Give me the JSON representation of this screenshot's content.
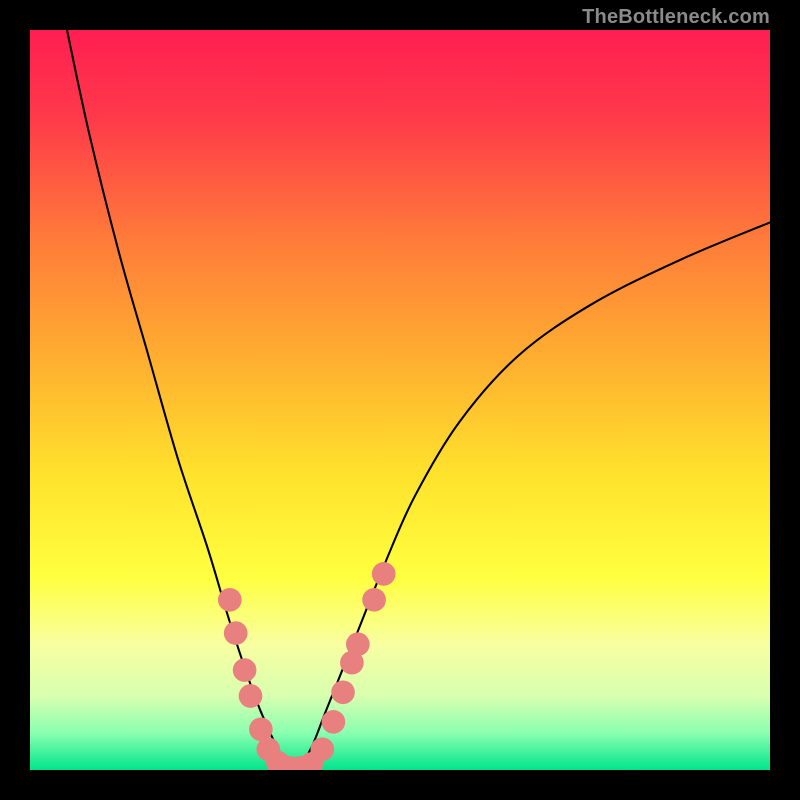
{
  "watermark": "TheBottleneck.com",
  "chart_data": {
    "type": "line",
    "title": "",
    "xlabel": "",
    "ylabel": "",
    "xlim": [
      0,
      100
    ],
    "ylim": [
      0,
      100
    ],
    "grid": false,
    "legend": false,
    "background_gradient": {
      "stops": [
        {
          "pos": 0.0,
          "color": "#ff1e52"
        },
        {
          "pos": 0.12,
          "color": "#ff3a4a"
        },
        {
          "pos": 0.28,
          "color": "#ff7a3a"
        },
        {
          "pos": 0.45,
          "color": "#ffb030"
        },
        {
          "pos": 0.6,
          "color": "#ffe22c"
        },
        {
          "pos": 0.74,
          "color": "#ffff40"
        },
        {
          "pos": 0.83,
          "color": "#f8ffa0"
        },
        {
          "pos": 0.9,
          "color": "#d8ffb0"
        },
        {
          "pos": 0.95,
          "color": "#8affb0"
        },
        {
          "pos": 1.0,
          "color": "#00e58a"
        }
      ]
    },
    "series": [
      {
        "name": "bottleneck-curve",
        "color": "#000000",
        "x": [
          5,
          8,
          12,
          16,
          20,
          24,
          27,
          30,
          32,
          34,
          36,
          38,
          40,
          44,
          48,
          52,
          58,
          66,
          76,
          88,
          100
        ],
        "y": [
          100,
          86,
          70,
          56,
          42,
          30,
          20,
          11,
          6,
          2,
          0,
          3,
          8,
          18,
          28,
          37,
          47,
          56,
          63,
          69,
          74
        ]
      }
    ],
    "markers": {
      "name": "highlight-dots",
      "color": "#e98080",
      "radius_pct": 1.6,
      "points": [
        {
          "x": 27.0,
          "y": 23.0
        },
        {
          "x": 27.8,
          "y": 18.5
        },
        {
          "x": 29.0,
          "y": 13.5
        },
        {
          "x": 29.8,
          "y": 10.0
        },
        {
          "x": 31.2,
          "y": 5.5
        },
        {
          "x": 32.2,
          "y": 2.8
        },
        {
          "x": 33.5,
          "y": 1.0
        },
        {
          "x": 35.0,
          "y": 0.3
        },
        {
          "x": 36.5,
          "y": 0.3
        },
        {
          "x": 38.0,
          "y": 0.8
        },
        {
          "x": 39.5,
          "y": 2.8
        },
        {
          "x": 41.0,
          "y": 6.5
        },
        {
          "x": 42.3,
          "y": 10.5
        },
        {
          "x": 43.5,
          "y": 14.5
        },
        {
          "x": 44.3,
          "y": 17.0
        },
        {
          "x": 46.5,
          "y": 23.0
        },
        {
          "x": 47.8,
          "y": 26.5
        }
      ]
    }
  }
}
